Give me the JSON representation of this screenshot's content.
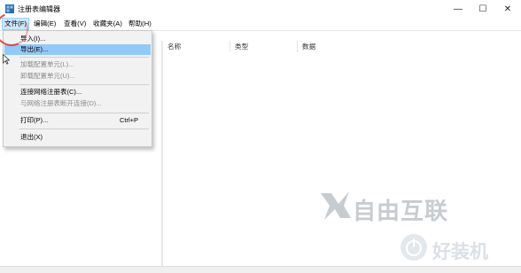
{
  "window": {
    "title": "注册表编辑器",
    "controls": {
      "minimize": "—",
      "maximize": "☐",
      "close": "✕"
    }
  },
  "menubar": {
    "items": [
      "文件(F)",
      "编辑(E)",
      "查看(V)",
      "收藏夹(A)",
      "帮助(H)"
    ]
  },
  "file_menu": {
    "items": [
      {
        "label": "导入(I)...",
        "enabled": true,
        "highlighted": false
      },
      {
        "label": "导出(E)...",
        "enabled": true,
        "highlighted": true
      },
      {
        "label": "加载配置单元(L)...",
        "enabled": false
      },
      {
        "label": "卸载配置单元(U)...",
        "enabled": false
      },
      {
        "label": "连接网络注册表(C)...",
        "enabled": true
      },
      {
        "label": "与网络注册表断开连接(D)...",
        "enabled": false
      },
      {
        "label": "打印(P)...",
        "enabled": true,
        "shortcut": "Ctrl+P"
      },
      {
        "label": "退出(X)",
        "enabled": true
      }
    ]
  },
  "list_view": {
    "columns": [
      "名称",
      "类型",
      "数据"
    ]
  },
  "watermarks": {
    "brand1": "自由互联",
    "brand2": "好装机"
  },
  "colors": {
    "menu_highlight": "#91c9f7",
    "menu_bg": "#f2f2f2",
    "file_menu_active": "#cce8ff"
  }
}
